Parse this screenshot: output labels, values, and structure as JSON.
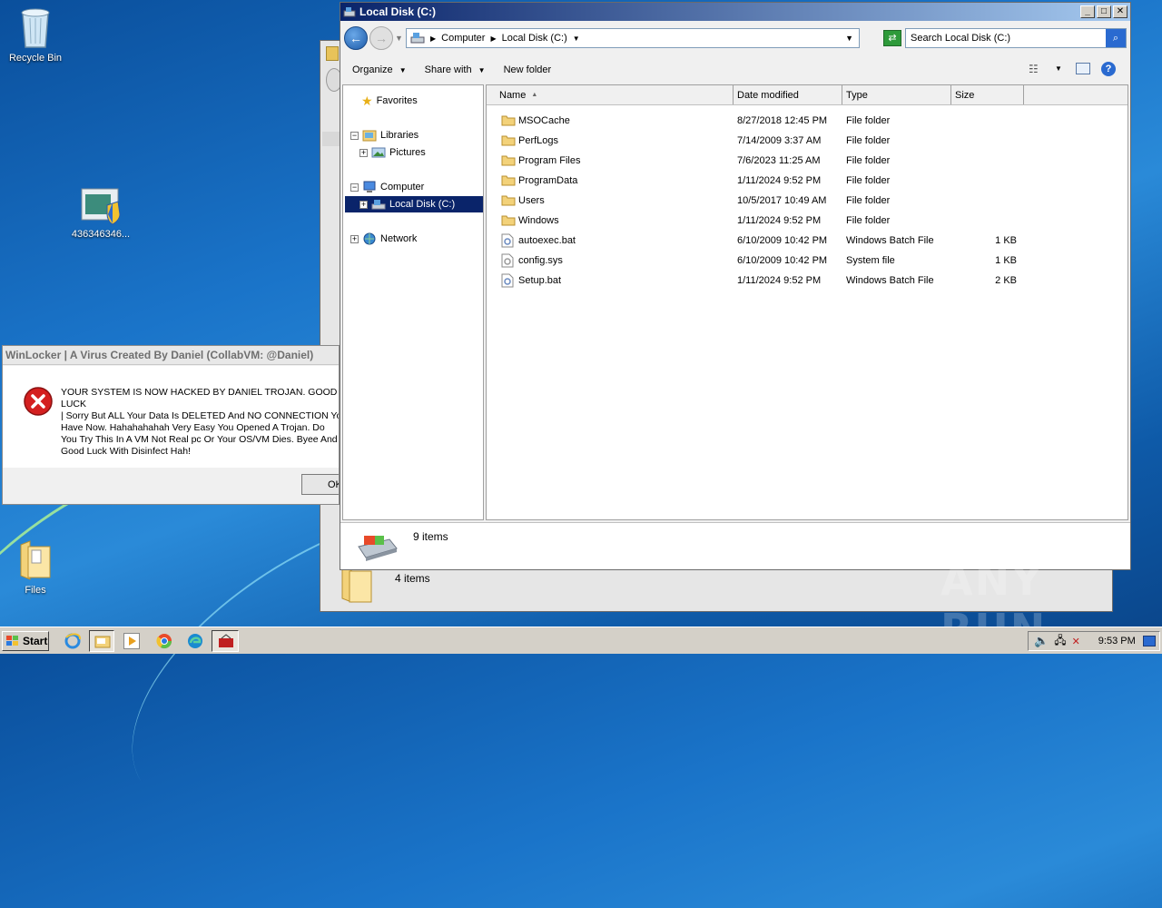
{
  "desktop": {
    "icons": [
      {
        "label": "Recycle Bin"
      },
      {
        "label": "436346346..."
      },
      {
        "label": "Files"
      }
    ],
    "watermark": "ANY RUN"
  },
  "explorer": {
    "title": "Local Disk (C:)",
    "breadcrumb": [
      "Computer",
      "Local Disk (C:)"
    ],
    "search_placeholder": "Search Local Disk (C:)",
    "commands": {
      "organize": "Organize",
      "share_with": "Share with",
      "new_folder": "New folder"
    },
    "nav": {
      "favorites": "Favorites",
      "libraries": "Libraries",
      "pictures": "Pictures",
      "computer": "Computer",
      "local_disk": "Local Disk (C:)",
      "network": "Network"
    },
    "columns": {
      "name": "Name",
      "date": "Date modified",
      "type": "Type",
      "size": "Size"
    },
    "files": [
      {
        "name": "MSOCache",
        "date": "8/27/2018 12:45 PM",
        "type": "File folder",
        "size": "",
        "icon": "folder-icon"
      },
      {
        "name": "PerfLogs",
        "date": "7/14/2009 3:37 AM",
        "type": "File folder",
        "size": "",
        "icon": "folder-icon"
      },
      {
        "name": "Program Files",
        "date": "7/6/2023 11:25 AM",
        "type": "File folder",
        "size": "",
        "icon": "folder-icon"
      },
      {
        "name": "ProgramData",
        "date": "1/11/2024 9:52 PM",
        "type": "File folder",
        "size": "",
        "icon": "folder-icon"
      },
      {
        "name": "Users",
        "date": "10/5/2017 10:49 AM",
        "type": "File folder",
        "size": "",
        "icon": "folder-icon"
      },
      {
        "name": "Windows",
        "date": "1/11/2024 9:52 PM",
        "type": "File folder",
        "size": "",
        "icon": "folder-icon"
      },
      {
        "name": "autoexec.bat",
        "date": "6/10/2009 10:42 PM",
        "type": "Windows Batch File",
        "size": "1 KB",
        "icon": "batch-file-icon"
      },
      {
        "name": "config.sys",
        "date": "6/10/2009 10:42 PM",
        "type": "System file",
        "size": "1 KB",
        "icon": "system-file-icon"
      },
      {
        "name": "Setup.bat",
        "date": "1/11/2024 9:52 PM",
        "type": "Windows Batch File",
        "size": "2 KB",
        "icon": "batch-file-icon"
      }
    ],
    "status": "9 items"
  },
  "back_window": {
    "status": "4 items"
  },
  "dialog": {
    "title": "WinLocker | A Virus Created By Daniel (CollabVM: @Daniel)",
    "message": "YOUR SYSTEM IS NOW HACKED BY DANIEL TROJAN. GOOD LUCK\n| Sorry But ALL Your Data Is DELETED And NO CONNECTION You\nHave Now. Hahahahahah Very Easy You Opened A Trojan. Do\nYou Try This In A VM Not Real pc Or  Your OS/VM Dies. Byee And\nGood Luck With Disinfect Hah!",
    "ok_label": "OK"
  },
  "taskbar": {
    "start_label": "Start",
    "clock": "9:53 PM"
  }
}
